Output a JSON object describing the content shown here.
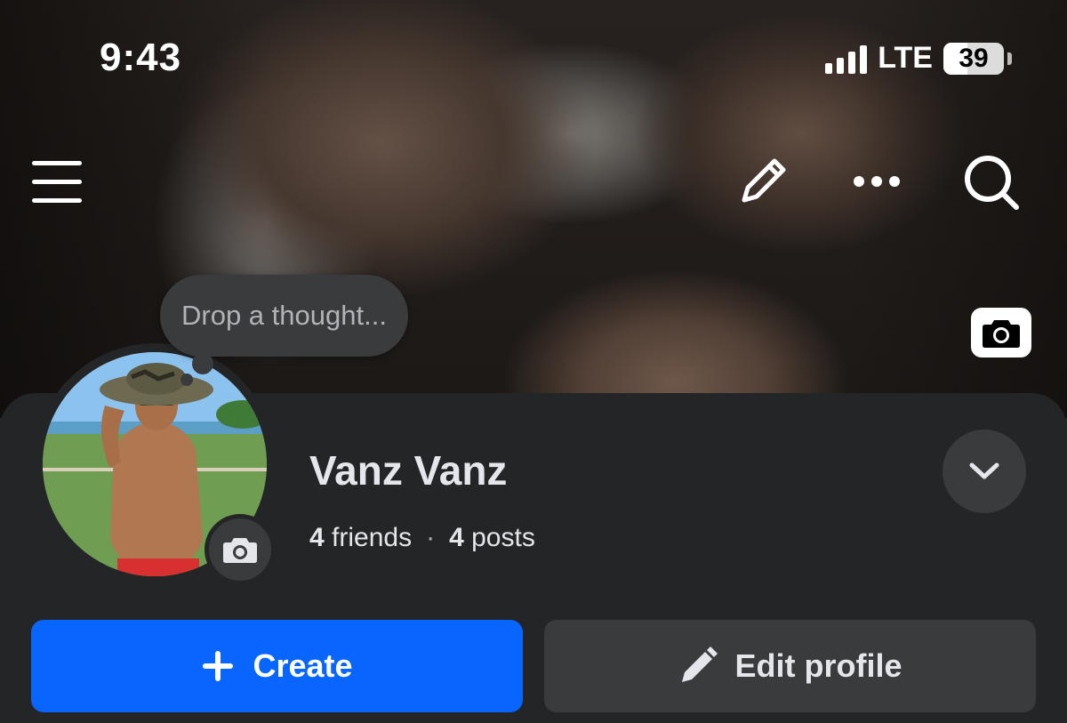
{
  "status_bar": {
    "time": "9:43",
    "network": "LTE",
    "battery": "39",
    "battery_level": 0.39
  },
  "nav": {
    "menu_icon": "hamburger-menu-icon",
    "edit_icon": "pencil-icon",
    "more_icon": "more-dots-icon",
    "search_icon": "search-icon"
  },
  "thought": {
    "placeholder": "Drop a thought..."
  },
  "profile": {
    "name": "Vanz Vanz",
    "friends_count": "4",
    "friends_label": "friends",
    "separator": "·",
    "posts_count": "4",
    "posts_label": "posts"
  },
  "actions": {
    "create_label": "Create",
    "edit_profile_label": "Edit profile"
  },
  "colors": {
    "accent": "#0866ff",
    "panel": "#242526",
    "button_secondary": "#3a3b3c"
  }
}
